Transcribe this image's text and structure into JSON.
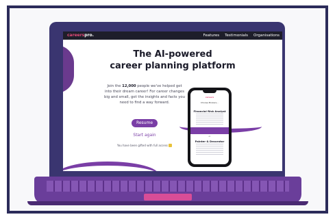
{
  "brand": {
    "name": "careers",
    "suffix": "pro.",
    "accent_color": "#e44b7a"
  },
  "nav": {
    "links": [
      "Features",
      "Testimonials",
      "Organisations"
    ]
  },
  "hero": {
    "headline_line1": "The AI-powered",
    "headline_line2": "career planning platform",
    "intro_prefix": "Join the ",
    "intro_count": "12,000",
    "intro_suffix": " people we've helped get into their dream career! For career changes big and small, get the insights and facts you need to find a way forward.",
    "resume_label": "Resume",
    "start_label": "Start again",
    "access_note": "You have been gifted with full access"
  },
  "phone": {
    "logo": "careers",
    "greeting": "Choose Brokers...",
    "card1_title": "Financial Risk Analyst",
    "divider": "or",
    "card2_title": "Painter & Decorator"
  },
  "colors": {
    "primary": "#7a3ea6",
    "laptop_lid": "#3a3570",
    "navbar": "#1e1e2a",
    "keyboard": "#6a3e9a"
  }
}
